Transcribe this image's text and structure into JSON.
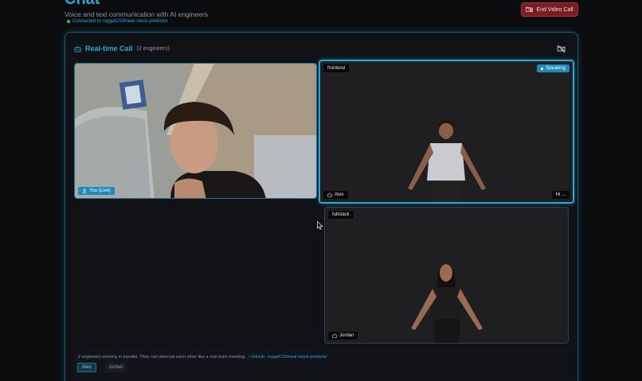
{
  "header": {
    "title": "Chat",
    "subtitle": "Voice and text communication with AI engineers",
    "connection": "Connected to roygalCS/linear-stock-predictor",
    "end_call_label": "End Video Call"
  },
  "panel": {
    "title": "Real-time Call",
    "count": "(2 engineers)"
  },
  "tiles": {
    "you": {
      "label": "You (Live)"
    },
    "alex": {
      "role": "frontend",
      "status": "Speaking",
      "name": "Alex",
      "caption": "Hi ..."
    },
    "jordan": {
      "role": "fullstack",
      "name": "Jordan"
    }
  },
  "footer": {
    "text": "2 engineers working in parallel. They can interrupt each other like a real team meeting.",
    "github": "• GitHub: roygalCS/linear-stock-predictor",
    "chips": [
      "Alex",
      "Jordan"
    ]
  },
  "colors": {
    "accent": "#2aa7d8",
    "danger": "#7a1d22",
    "live": "#27c26b"
  }
}
